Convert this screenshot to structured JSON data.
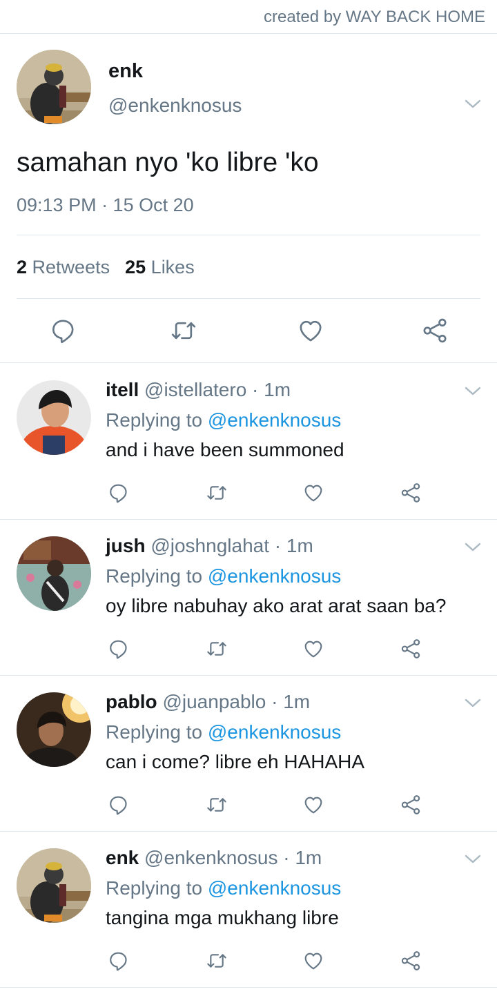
{
  "credit": "created by WAY BACK HOME",
  "main_tweet": {
    "name": "enk",
    "handle": "@enkenknosus",
    "text": "samahan nyo 'ko libre 'ko",
    "timestamp": "09:13 PM · 15 Oct 20",
    "retweet_count": "2",
    "retweet_label": "Retweets",
    "like_count": "25",
    "like_label": "Likes",
    "icons": [
      "reply-icon",
      "retweet-icon",
      "like-icon",
      "share-icon"
    ]
  },
  "replies": [
    {
      "name": "itell",
      "meta": "@istellatero · 1m",
      "replying_prefix": "Replying to",
      "replying_to": "@enkenknosus",
      "text": "and i have been summoned"
    },
    {
      "name": "jush",
      "meta": "@joshnglahat · 1m",
      "replying_prefix": "Replying to",
      "replying_to": "@enkenknosus",
      "text": "oy libre nabuhay ako arat arat saan ba?"
    },
    {
      "name": "pablo",
      "meta": "@juanpablo · 1m",
      "replying_prefix": "Replying to",
      "replying_to": "@enkenknosus",
      "text": "can i come? libre eh HAHAHA"
    },
    {
      "name": "enk",
      "meta": "@enkenknosus · 1m",
      "replying_prefix": "Replying to",
      "replying_to": "@enkenknosus",
      "text": "tangina mga mukhang libre"
    }
  ],
  "colors": {
    "text": "#14171a",
    "secondary": "#657786",
    "link": "#1b95e0",
    "divider": "#e1e8ed"
  }
}
